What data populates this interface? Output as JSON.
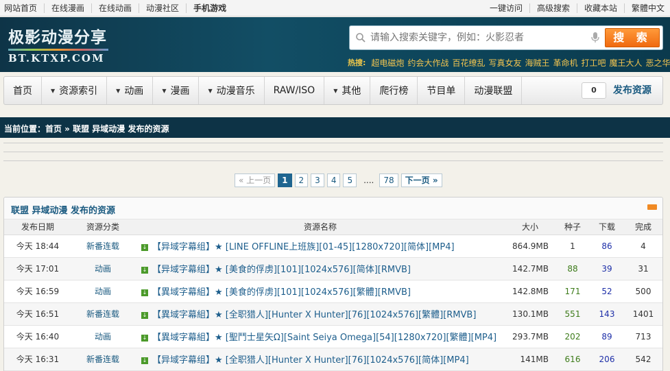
{
  "topbar": {
    "left_links": [
      "网站首页",
      "在线漫画",
      "在线动画",
      "动漫社区",
      "手机游戏"
    ],
    "right_links": [
      "一键访问",
      "高级搜索",
      "收藏本站",
      "繁體中文"
    ]
  },
  "header": {
    "logo_cn": "极影动漫分享",
    "logo_en": "BT.KTXP.COM",
    "search_placeholder": "请输入搜索关键字，例如：火影忍者",
    "search_button": "搜 索",
    "hot_label": "热搜:",
    "hot_links": [
      "超电磁炮",
      "约会大作战",
      "百花缭乱",
      "写真女友",
      "海贼王",
      "革命机",
      "打工吧",
      "魔王大人",
      "恶之华"
    ]
  },
  "nav": {
    "items": [
      {
        "label": "首页",
        "dropdown": false
      },
      {
        "label": "资源索引",
        "dropdown": true
      },
      {
        "label": "动画",
        "dropdown": true
      },
      {
        "label": "漫画",
        "dropdown": true
      },
      {
        "label": "动漫音乐",
        "dropdown": true
      },
      {
        "label": "RAW/ISO",
        "dropdown": false
      },
      {
        "label": "其他",
        "dropdown": true
      },
      {
        "label": "爬行榜",
        "dropdown": false
      },
      {
        "label": "节目单",
        "dropdown": false
      },
      {
        "label": "动漫联盟",
        "dropdown": false
      }
    ],
    "count": "0",
    "publish": "发布资源"
  },
  "breadcrumb": "当前位置：首页 » 联盟 异域动漫 发布的资源",
  "pager": {
    "prev": "« 上一页",
    "pages": [
      "1",
      "2",
      "3",
      "4",
      "5"
    ],
    "current": "1",
    "dots": "....",
    "last": "78",
    "next": "下一页 »"
  },
  "panel": {
    "title": "联盟 异域动漫 发布的资源",
    "columns": [
      "发布日期",
      "资源分类",
      "资源名称",
      "大小",
      "种子",
      "下载",
      "完成"
    ],
    "rows": [
      {
        "date": "今天 18:44",
        "cat": "新番连载",
        "name": "【异域字幕组】★ [LINE OFFLINE上班族][01-45][1280x720][简体][MP4]",
        "size": "864.9MB",
        "seed": "1",
        "dl": "86",
        "done": "4"
      },
      {
        "date": "今天 17:01",
        "cat": "动画",
        "name": "【异域字幕组】★ [美食的俘虏][101][1024x576][简体][RMVB]",
        "size": "142.7MB",
        "seed": "88",
        "dl": "39",
        "done": "31"
      },
      {
        "date": "今天 16:59",
        "cat": "动画",
        "name": "【異域字幕組】★ [美食的俘虏][101][1024x576][繁體][RMVB]",
        "size": "142.8MB",
        "seed": "171",
        "dl": "52",
        "done": "500"
      },
      {
        "date": "今天 16:51",
        "cat": "新番连载",
        "name": "【異域字幕組】★ [全职猎人][Hunter X Hunter][76][1024x576][繁體][RMVB]",
        "size": "130.1MB",
        "seed": "551",
        "dl": "143",
        "done": "1401"
      },
      {
        "date": "今天 16:40",
        "cat": "动画",
        "name": "【異域字幕組】★ [聖鬥士星矢Ω][Saint Seiya Omega][54][1280x720][繁體][MP4]",
        "size": "293.7MB",
        "seed": "202",
        "dl": "89",
        "done": "713"
      },
      {
        "date": "今天 16:31",
        "cat": "新番连载",
        "name": "【异域字幕组】★ [全职猎人][Hunter X Hunter][76][1024x576][简体][MP4]",
        "size": "141MB",
        "seed": "616",
        "dl": "206",
        "done": "542"
      }
    ]
  },
  "colors": {
    "header_dark": "#0e3447",
    "accent_orange": "#f06a10",
    "link_blue": "#1a5a80",
    "seed_green": "#3d7b1a"
  }
}
